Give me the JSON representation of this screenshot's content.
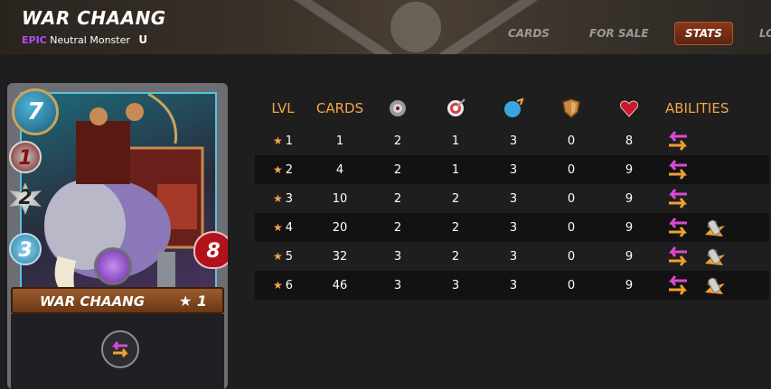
{
  "header": {
    "title": "WAR CHAANG",
    "rarity": "EPIC",
    "type": "Neutral Monster",
    "edition_mark": "U"
  },
  "tabs": [
    {
      "label": "CARDS",
      "active": false
    },
    {
      "label": "FOR SALE",
      "active": false
    },
    {
      "label": "STATS",
      "active": true
    },
    {
      "label": "LO",
      "active": false
    }
  ],
  "card": {
    "name": "WAR CHAANG",
    "level": "★ 1",
    "mana": "7",
    "melee": "1",
    "ranged": "2",
    "speed": "3",
    "health": "8"
  },
  "table": {
    "headers": {
      "lvl": "LVL",
      "cards": "CARDS",
      "melee_icon": "melee-attack-icon",
      "ranged_icon": "ranged-attack-icon",
      "speed_icon": "speed-icon",
      "armor_icon": "armor-icon",
      "health_icon": "health-icon",
      "abilities": "ABILITIES"
    },
    "rows": [
      {
        "lvl": "1",
        "cards": "1",
        "melee": "2",
        "ranged": "1",
        "speed": "3",
        "armor": "0",
        "health": "8",
        "abilities": [
          "retaliate-swap-icon"
        ]
      },
      {
        "lvl": "2",
        "cards": "4",
        "melee": "2",
        "ranged": "1",
        "speed": "3",
        "armor": "0",
        "health": "9",
        "abilities": [
          "retaliate-swap-icon"
        ]
      },
      {
        "lvl": "3",
        "cards": "10",
        "melee": "2",
        "ranged": "2",
        "speed": "3",
        "armor": "0",
        "health": "9",
        "abilities": [
          "retaliate-swap-icon"
        ]
      },
      {
        "lvl": "4",
        "cards": "20",
        "melee": "2",
        "ranged": "2",
        "speed": "3",
        "armor": "0",
        "health": "9",
        "abilities": [
          "retaliate-swap-icon",
          "shatter-icon"
        ]
      },
      {
        "lvl": "5",
        "cards": "32",
        "melee": "3",
        "ranged": "2",
        "speed": "3",
        "armor": "0",
        "health": "9",
        "abilities": [
          "retaliate-swap-icon",
          "shatter-icon"
        ]
      },
      {
        "lvl": "6",
        "cards": "46",
        "melee": "3",
        "ranged": "3",
        "speed": "3",
        "armor": "0",
        "health": "9",
        "abilities": [
          "retaliate-swap-icon",
          "shatter-icon"
        ]
      }
    ]
  },
  "colors": {
    "accent_orange": "#f2a74a",
    "rarity_epic": "#b34dff",
    "active_tab": "#8a3a1a"
  }
}
